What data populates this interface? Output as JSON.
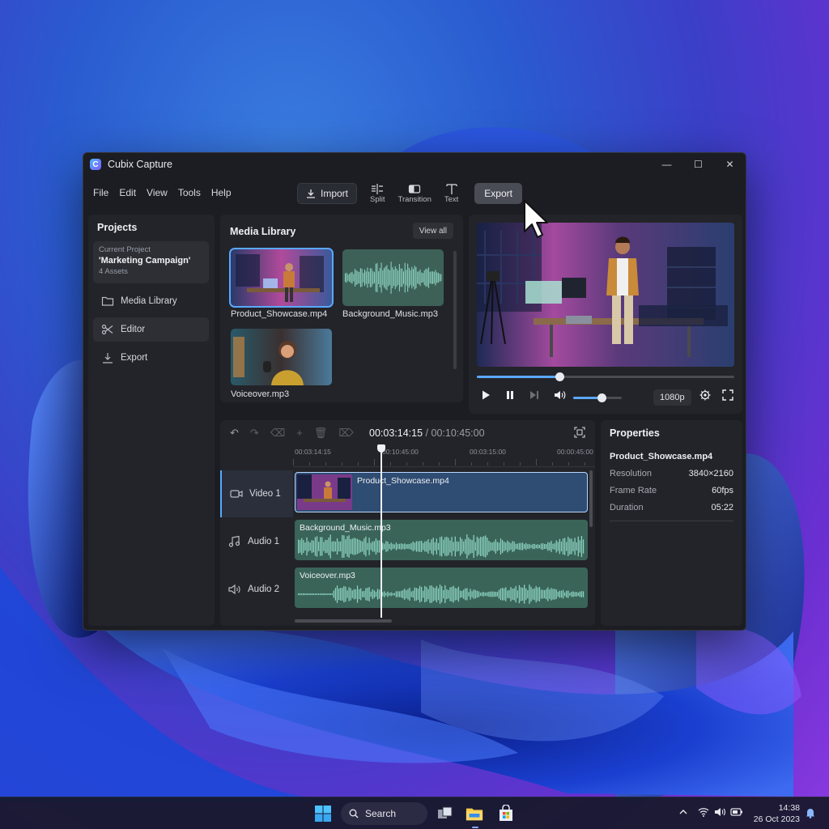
{
  "app": {
    "title": "Cubix Capture",
    "logo_letter": "C"
  },
  "window_controls": {
    "minimize": "—",
    "maximize": "☐",
    "close": "✕"
  },
  "menu": [
    "File",
    "Edit",
    "View",
    "Tools",
    "Help"
  ],
  "toolbar": {
    "import_label": "Import",
    "split_label": "Split",
    "transition_label": "Transition",
    "text_label": "Text",
    "export_label": "Export"
  },
  "sidebar": {
    "title": "Projects",
    "current_project_label": "Current Project",
    "current_project_name": "'Marketing Campaign'",
    "current_project_assets": "4 Assets",
    "items": [
      {
        "label": "Media Library",
        "icon": "folder-icon"
      },
      {
        "label": "Editor",
        "icon": "scissors-icon",
        "active": true
      },
      {
        "label": "Export",
        "icon": "download-icon"
      }
    ]
  },
  "media_library": {
    "title": "Media Library",
    "view_all": "View all",
    "items": [
      {
        "name": "Product_Showcase.mp4",
        "type": "video",
        "selected": true
      },
      {
        "name": "Background_Music.mp3",
        "type": "audio"
      },
      {
        "name": "Voiceover.mp3",
        "type": "video"
      }
    ]
  },
  "preview": {
    "progress": 0.32,
    "volume": 0.58,
    "resolution": "1080p"
  },
  "timeline": {
    "current_time": "00:03:14:15",
    "separator": "/",
    "total_time": "00:10:45:00",
    "ruler_ticks": [
      "00:03:14:15",
      "00:10:45:00",
      "00:03:15:00",
      "00:00:45:00"
    ],
    "tracks": [
      {
        "name": "Video 1",
        "icon": "video-camera-icon",
        "clip": "Product_Showcase.mp4"
      },
      {
        "name": "Audio 1",
        "icon": "music-note-icon",
        "clip": "Background_Music.mp3"
      },
      {
        "name": "Audio 2",
        "icon": "speaker-icon",
        "clip": "Voiceover.mp3"
      }
    ]
  },
  "properties": {
    "title": "Properties",
    "file": "Product_Showcase.mp4",
    "rows": [
      {
        "key": "Resolution",
        "value": "3840×2160"
      },
      {
        "key": "Frame Rate",
        "value": "60fps"
      },
      {
        "key": "Duration",
        "value": "05:22"
      }
    ]
  },
  "taskbar": {
    "search_label": "Search",
    "time": "14:38",
    "date": "26 Oct 2023"
  },
  "colors": {
    "accent": "#5aa8ff",
    "window_bg": "#1c1d22",
    "panel_bg": "#232429",
    "audio_clip": "#3a6458",
    "video_clip": "#2f4c72"
  }
}
